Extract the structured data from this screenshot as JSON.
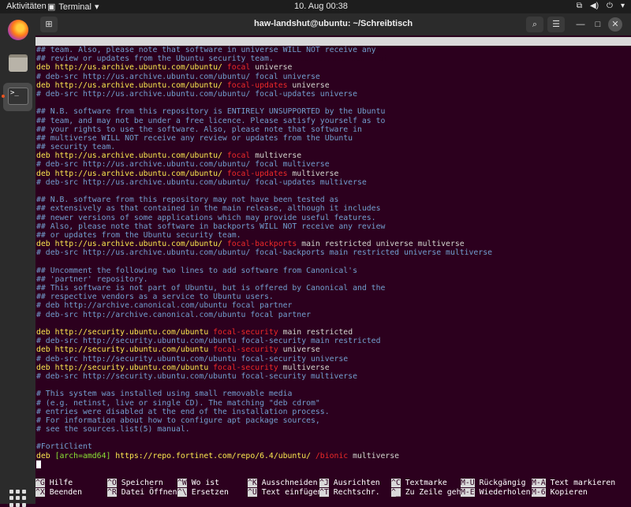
{
  "topbar": {
    "activities": "Aktivitäten",
    "app_name": "Terminal",
    "clock": "10. Aug  00:38"
  },
  "dock": {
    "items": [
      {
        "name": "firefox-icon"
      },
      {
        "name": "files-icon"
      },
      {
        "name": "terminal-icon",
        "glyph": ">_",
        "active": true
      }
    ]
  },
  "window": {
    "title": "haw-landshut@ubuntu: ~/Schreibtisch"
  },
  "nano": {
    "version": "GNU nano 4.8",
    "filename": "/etc/apt/sources.list"
  },
  "lines": [
    [
      [
        "c",
        "## team. Also, please note that software in universe WILL NOT receive any"
      ]
    ],
    [
      [
        "c",
        "## review or updates from the Ubuntu security team."
      ]
    ],
    [
      [
        "d",
        "deb "
      ],
      [
        "u",
        "http://us.archive.ubuntu.com/ubuntu/ "
      ],
      [
        "r",
        "focal"
      ],
      [
        "p",
        " universe"
      ]
    ],
    [
      [
        "c",
        "# deb-src http://us.archive.ubuntu.com/ubuntu/ focal universe"
      ]
    ],
    [
      [
        "d",
        "deb "
      ],
      [
        "u",
        "http://us.archive.ubuntu.com/ubuntu/ "
      ],
      [
        "r",
        "focal-updates"
      ],
      [
        "p",
        " universe"
      ]
    ],
    [
      [
        "c",
        "# deb-src http://us.archive.ubuntu.com/ubuntu/ focal-updates universe"
      ]
    ],
    [],
    [
      [
        "c",
        "## N.B. software from this repository is ENTIRELY UNSUPPORTED by the Ubuntu"
      ]
    ],
    [
      [
        "c",
        "## team, and may not be under a free licence. Please satisfy yourself as to"
      ]
    ],
    [
      [
        "c",
        "## your rights to use the software. Also, please note that software in"
      ]
    ],
    [
      [
        "c",
        "## multiverse WILL NOT receive any review or updates from the Ubuntu"
      ]
    ],
    [
      [
        "c",
        "## security team."
      ]
    ],
    [
      [
        "d",
        "deb "
      ],
      [
        "u",
        "http://us.archive.ubuntu.com/ubuntu/ "
      ],
      [
        "r",
        "focal"
      ],
      [
        "p",
        " multiverse"
      ]
    ],
    [
      [
        "c",
        "# deb-src http://us.archive.ubuntu.com/ubuntu/ focal multiverse"
      ]
    ],
    [
      [
        "d",
        "deb "
      ],
      [
        "u",
        "http://us.archive.ubuntu.com/ubuntu/ "
      ],
      [
        "r",
        "focal-updates"
      ],
      [
        "p",
        " multiverse"
      ]
    ],
    [
      [
        "c",
        "# deb-src http://us.archive.ubuntu.com/ubuntu/ focal-updates multiverse"
      ]
    ],
    [],
    [
      [
        "c",
        "## N.B. software from this repository may not have been tested as"
      ]
    ],
    [
      [
        "c",
        "## extensively as that contained in the main release, although it includes"
      ]
    ],
    [
      [
        "c",
        "## newer versions of some applications which may provide useful features."
      ]
    ],
    [
      [
        "c",
        "## Also, please note that software in backports WILL NOT receive any review"
      ]
    ],
    [
      [
        "c",
        "## or updates from the Ubuntu security team."
      ]
    ],
    [
      [
        "d",
        "deb "
      ],
      [
        "u",
        "http://us.archive.ubuntu.com/ubuntu/ "
      ],
      [
        "r",
        "focal-backports"
      ],
      [
        "p",
        " main restricted universe multiverse"
      ]
    ],
    [
      [
        "c",
        "# deb-src http://us.archive.ubuntu.com/ubuntu/ focal-backports main restricted universe multiverse"
      ]
    ],
    [],
    [
      [
        "c",
        "## Uncomment the following two lines to add software from Canonical's"
      ]
    ],
    [
      [
        "c",
        "## 'partner' repository."
      ]
    ],
    [
      [
        "c",
        "## This software is not part of Ubuntu, but is offered by Canonical and the"
      ]
    ],
    [
      [
        "c",
        "## respective vendors as a service to Ubuntu users."
      ]
    ],
    [
      [
        "c",
        "# deb http://archive.canonical.com/ubuntu focal partner"
      ]
    ],
    [
      [
        "c",
        "# deb-src http://archive.canonical.com/ubuntu focal partner"
      ]
    ],
    [],
    [
      [
        "d",
        "deb "
      ],
      [
        "u",
        "http://security.ubuntu.com/ubuntu "
      ],
      [
        "r",
        "focal-security"
      ],
      [
        "p",
        " main restricted"
      ]
    ],
    [
      [
        "c",
        "# deb-src http://security.ubuntu.com/ubuntu focal-security main restricted"
      ]
    ],
    [
      [
        "d",
        "deb "
      ],
      [
        "u",
        "http://security.ubuntu.com/ubuntu "
      ],
      [
        "r",
        "focal-security"
      ],
      [
        "p",
        " universe"
      ]
    ],
    [
      [
        "c",
        "# deb-src http://security.ubuntu.com/ubuntu focal-security universe"
      ]
    ],
    [
      [
        "d",
        "deb "
      ],
      [
        "u",
        "http://security.ubuntu.com/ubuntu "
      ],
      [
        "r",
        "focal-security"
      ],
      [
        "p",
        " multiverse"
      ]
    ],
    [
      [
        "c",
        "# deb-src http://security.ubuntu.com/ubuntu focal-security multiverse"
      ]
    ],
    [],
    [
      [
        "c",
        "# This system was installed using small removable media"
      ]
    ],
    [
      [
        "c",
        "# (e.g. netinst, live or single CD). The matching \"deb cdrom\""
      ]
    ],
    [
      [
        "c",
        "# entries were disabled at the end of the installation process."
      ]
    ],
    [
      [
        "c",
        "# For information about how to configure apt package sources,"
      ]
    ],
    [
      [
        "c",
        "# see the sources.list(5) manual."
      ]
    ],
    [],
    [
      [
        "c",
        "#FortiClient"
      ]
    ],
    [
      [
        "d",
        "deb "
      ],
      [
        "o",
        "[arch=amd64]"
      ],
      [
        "u",
        " https://repo.fortinet.com/repo/6.4/ubuntu/ "
      ],
      [
        "r",
        "/bionic"
      ],
      [
        "p",
        " multiverse"
      ]
    ]
  ],
  "shortcuts": [
    [
      {
        "key": "^G",
        "label": "Hilfe"
      },
      {
        "key": "^X",
        "label": "Beenden"
      }
    ],
    [
      {
        "key": "^O",
        "label": "Speichern"
      },
      {
        "key": "^R",
        "label": "Datei Öffnen"
      }
    ],
    [
      {
        "key": "^W",
        "label": "Wo ist"
      },
      {
        "key": "^\\",
        "label": "Ersetzen"
      }
    ],
    [
      {
        "key": "^K",
        "label": "Ausschneiden"
      },
      {
        "key": "^U",
        "label": "Text einfügen"
      }
    ],
    [
      {
        "key": "^J",
        "label": "Ausrichten"
      },
      {
        "key": "^T",
        "label": "Rechtschr."
      }
    ],
    [
      {
        "key": "^C",
        "label": "Textmarke"
      },
      {
        "key": "^_",
        "label": "Zu Zeile gehe"
      }
    ],
    [
      {
        "key": "M-U",
        "label": "Rückgängig"
      },
      {
        "key": "M-E",
        "label": "Wiederholen"
      }
    ],
    [
      {
        "key": "M-A",
        "label": "Text markieren"
      },
      {
        "key": "M-6",
        "label": "Kopieren"
      }
    ]
  ],
  "colors": {
    "terminal_bg": "#2c001e",
    "comment": "#729fcf",
    "keyword": "#fce94f",
    "distribution": "#ef2929",
    "option": "#8ae234"
  }
}
